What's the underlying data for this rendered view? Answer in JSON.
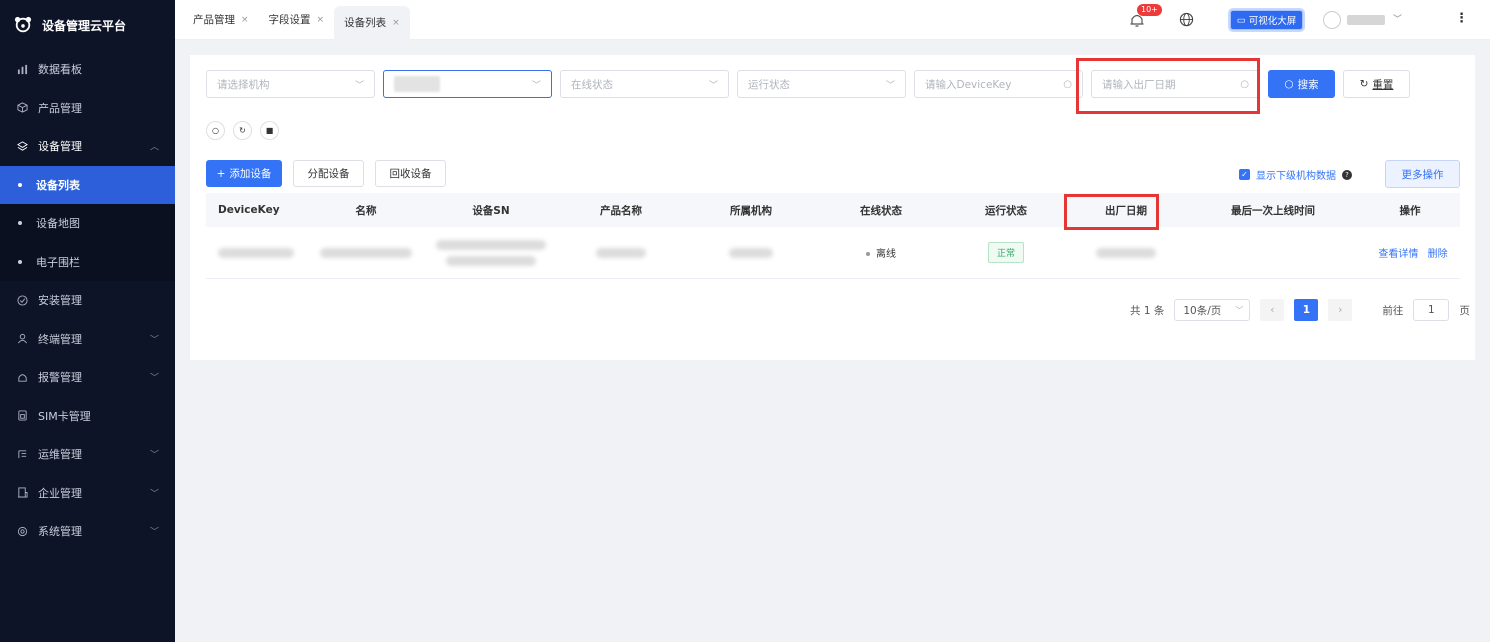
{
  "sidebar": {
    "logo_text": "设备管理云平台",
    "items": [
      {
        "label": "数据看板",
        "icon": "bar-chart-icon",
        "chevron": false
      },
      {
        "label": "产品管理",
        "icon": "cube-icon",
        "chevron": false
      },
      {
        "label": "设备管理",
        "icon": "layers-icon",
        "chevron": true,
        "open": true
      }
    ],
    "subitems": [
      {
        "label": "设备列表",
        "active": true
      },
      {
        "label": "设备地图",
        "active": false
      },
      {
        "label": "电子围栏",
        "active": false
      }
    ],
    "items_after": [
      {
        "label": "安装管理",
        "icon": "check-circle-icon",
        "chevron": false
      },
      {
        "label": "终端管理",
        "icon": "user-icon",
        "chevron": true
      },
      {
        "label": "报警管理",
        "icon": "alarm-icon",
        "chevron": true
      },
      {
        "label": "SIM卡管理",
        "icon": "sim-card-icon",
        "chevron": false
      },
      {
        "label": "运维管理",
        "icon": "tool-icon",
        "chevron": true
      },
      {
        "label": "企业管理",
        "icon": "building-icon",
        "chevron": true
      },
      {
        "label": "系统管理",
        "icon": "settings-icon",
        "chevron": true
      }
    ]
  },
  "tabs": [
    {
      "label": "产品管理",
      "close": "×",
      "active": false
    },
    {
      "label": "字段设置",
      "close": "×",
      "active": false
    },
    {
      "label": "设备列表",
      "close": "×",
      "active": true
    }
  ],
  "header": {
    "badge": "10+",
    "bigscreen_label": "可视化大屏"
  },
  "filters": {
    "org_placeholder": "请选择机构",
    "online_placeholder": "在线状态",
    "run_placeholder": "运行状态",
    "devicekey_placeholder": "请输入DeviceKey",
    "date_placeholder": "请输入出厂日期",
    "search_label": "搜索",
    "reset_label": "重置"
  },
  "actions": {
    "add_label": "添加设备",
    "assign_label": "分配设备",
    "recycle_label": "回收设备",
    "show_sub_label": "显示下级机构数据",
    "more_label": "更多操作"
  },
  "table": {
    "headers": [
      "DeviceKey",
      "名称",
      "设备SN",
      "产品名称",
      "所属机构",
      "在线状态",
      "运行状态",
      "出厂日期",
      "最后一次上线时间",
      "操作"
    ],
    "row": {
      "online": "离线",
      "run": "正常",
      "view_link": "查看详情",
      "delete_link": "删除"
    }
  },
  "pagination": {
    "total": "共 1 条",
    "page_size": "10条/页",
    "current": "1",
    "goto_label": "前往",
    "goto_value": "1",
    "page_suffix": "页"
  },
  "colors": {
    "primary": "#3473f6",
    "sidebar_bg": "#0e1428",
    "highlight": "#e53535"
  }
}
